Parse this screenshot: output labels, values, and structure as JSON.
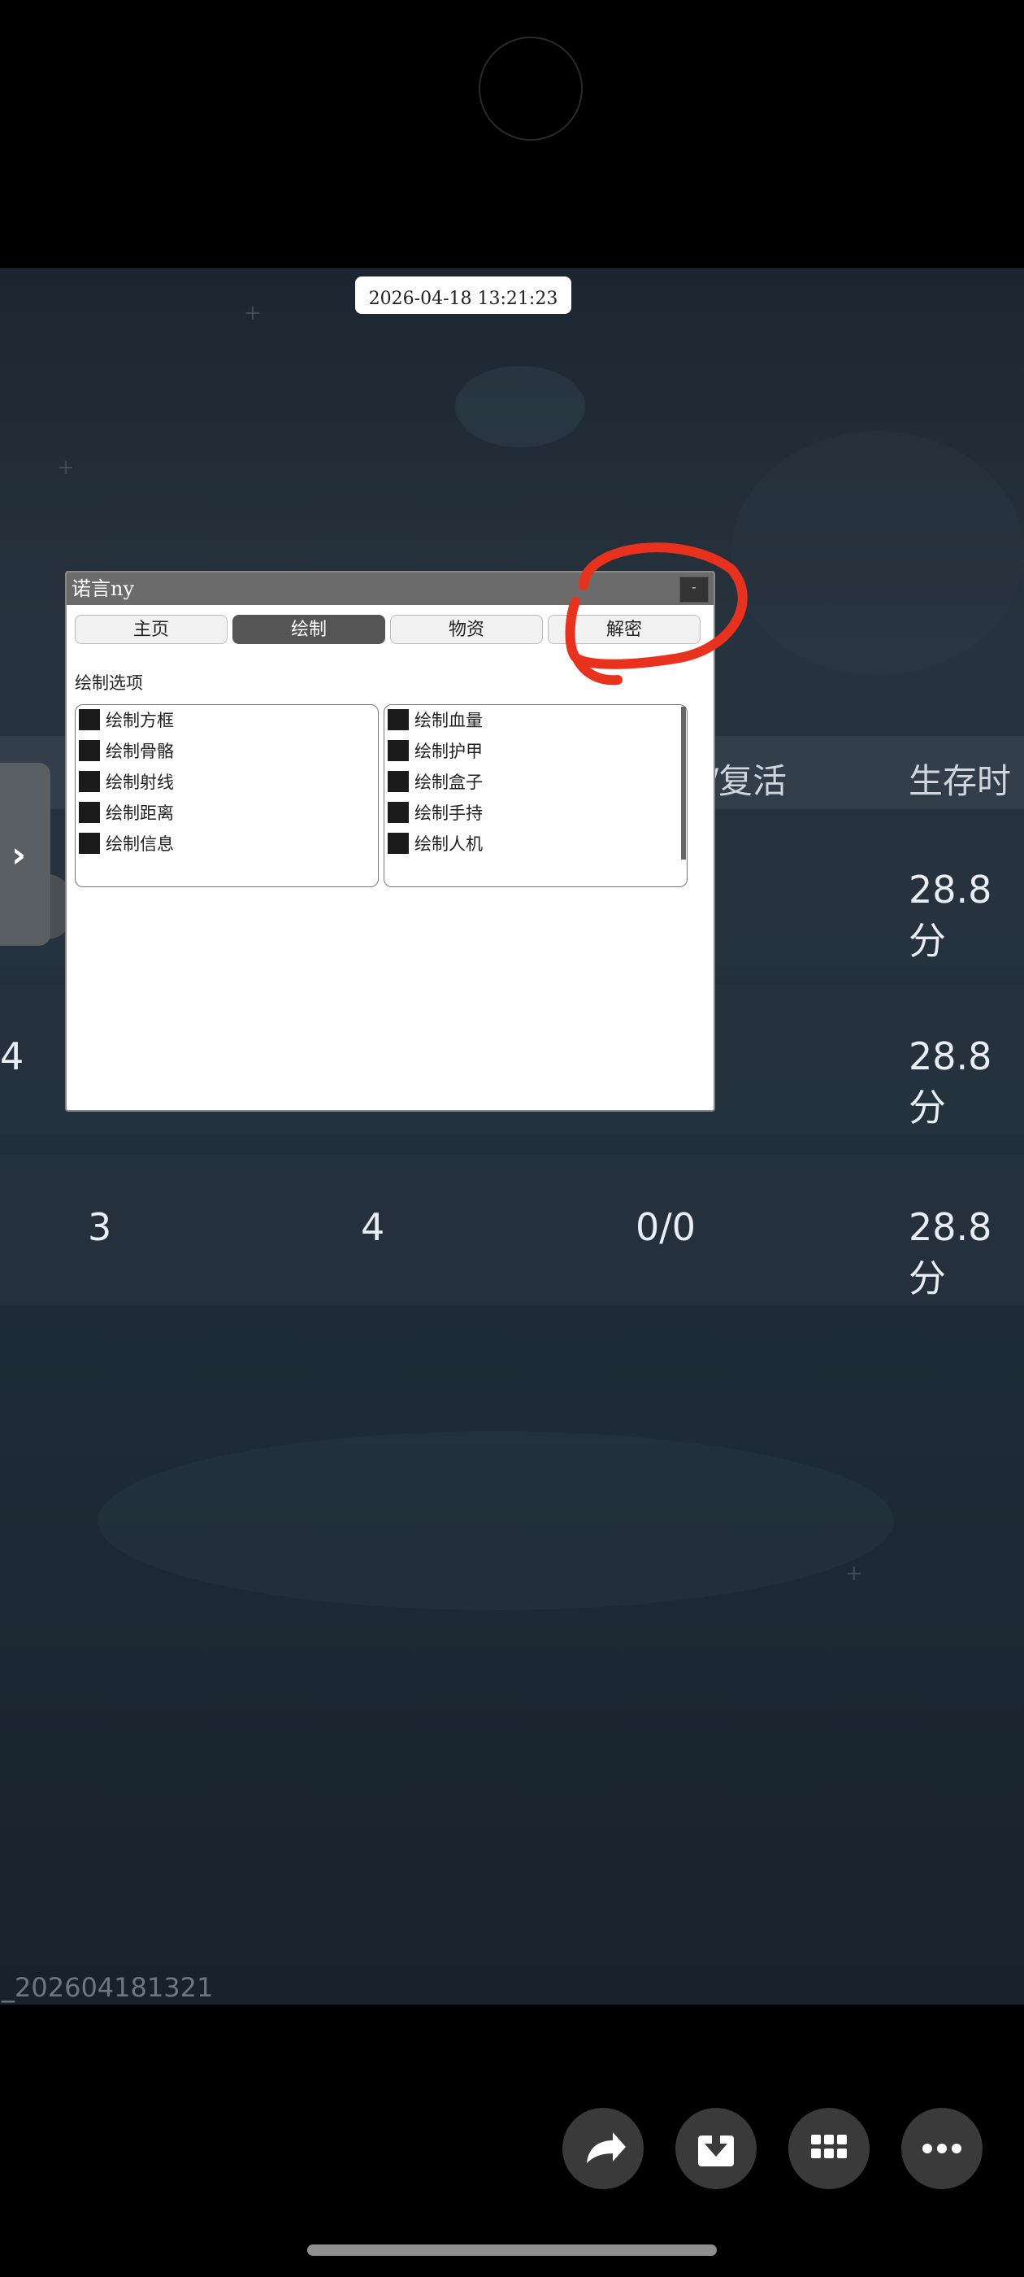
{
  "status": {
    "timestamp": "2026-04-18 13:21:23"
  },
  "stats_table": {
    "header_revive": "/复活",
    "header_survive": "生存时",
    "rows": [
      {
        "col_a": "",
        "col_b": "",
        "col_c": "",
        "survival": "28.8分"
      },
      {
        "col_a": "4",
        "col_b": "",
        "col_c": "",
        "survival": "28.8分"
      },
      {
        "col_a": "3",
        "col_b": "4",
        "col_c": "0/0",
        "survival": "28.8分"
      }
    ]
  },
  "watermark": "_202604181321",
  "menu": {
    "title": "诺言ny",
    "close_label": "-",
    "tabs": [
      {
        "label": "主页",
        "active": false
      },
      {
        "label": "绘制",
        "active": true
      },
      {
        "label": "物资",
        "active": false
      },
      {
        "label": "解密",
        "active": false
      }
    ],
    "section_label": "绘制选项",
    "left_options": [
      "绘制方框",
      "绘制骨骼",
      "绘制射线",
      "绘制距离",
      "绘制信息"
    ],
    "right_options": [
      "绘制血量",
      "绘制护甲",
      "绘制盒子",
      "绘制手持",
      "绘制人机"
    ]
  },
  "annotation": {
    "color": "#e8321e"
  },
  "bottom_actions": [
    "share-icon",
    "download-icon",
    "apps-icon",
    "more-icon"
  ]
}
